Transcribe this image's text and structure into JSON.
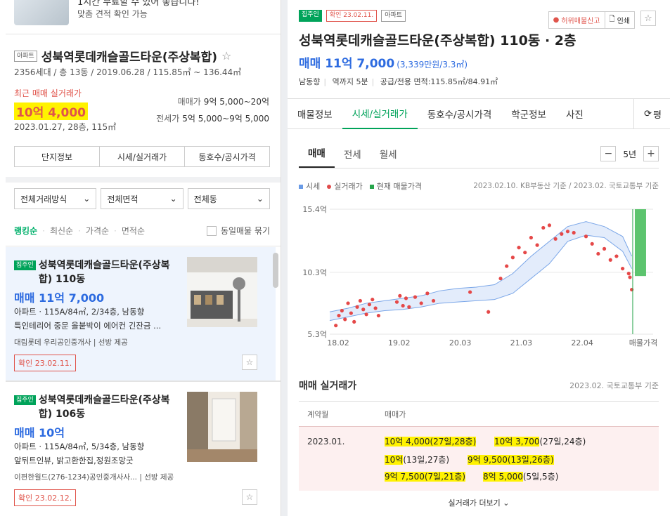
{
  "banner": {
    "line1": "1시간 무료할 수 있어 좋습니다!",
    "line2": "맞춤 견적 확인 가능"
  },
  "complex": {
    "type_tag": "아파트",
    "name": "성북역롯데캐슬골드타운(주상복합)",
    "meta": "2356세대 / 총 13동 / 2019.06.28 / 115.85㎡ ~ 136.44㎡",
    "recent_label": "최근 매매 실거래가",
    "recent_price": "10억 4,000",
    "recent_date": "2023.01.27, 28층, 115㎡",
    "sale_label": "매매가",
    "sale_range": "9억 5,000~20억",
    "jeonse_label": "전세가",
    "jeonse_range": "5억 5,000~9억 5,000",
    "buttons": [
      "단지정보",
      "시세/실거래가",
      "동호수/공시가격"
    ]
  },
  "filters": [
    "전체거래방식",
    "전체면적",
    "전체동"
  ],
  "sorts": {
    "items": [
      "랭킹순",
      "최신순",
      "가격순",
      "면적순"
    ],
    "group_label": "동일매물 묶기"
  },
  "listings": [
    {
      "tag": "집주인",
      "title": "성북역롯데캐슬골드타운(주상복합) 110동",
      "price": "매매 11억 7,000",
      "spec": "아파트 · 115A/84㎡, 2/34층, 남동향",
      "desc": "특인테리어 중문 올붙박이 에어컨 긴잔금 ...",
      "agent": "대림롯데 우리공인중개사 | 선방 제공",
      "confirm": "확인 23.02.11."
    },
    {
      "tag": "집주인",
      "title": "성북역롯데캐슬골드타운(주상복합) 106동",
      "price": "매매 10억",
      "spec": "아파트 · 115A/84㎡, 5/34층, 남동향",
      "desc": "앞뒤트인뷰, 밝고환한집,정원조망굿",
      "agent": "이편한월드(276-1234)공인중개사사... | 선방 제공",
      "confirm": "확인 23.02.12."
    }
  ],
  "detail": {
    "tags": [
      "집주인",
      "확인 23.02.11.",
      "아파트"
    ],
    "report_label": "허위매물신고",
    "print_label": "인쇄",
    "title": "성북역롯데캐슬골드타운(주상복합) 110동 · 2층",
    "price": "매매 11억 7,000",
    "price_per": "(3,339만원/3.3㎡)",
    "meta": [
      "남동향",
      "역까지 5분",
      "공급/전용 면적:115.85㎡/84.91㎡"
    ],
    "tabs": [
      "매물정보",
      "시세/실거래가",
      "동호수/공시가격",
      "학군정보",
      "사진"
    ],
    "refresh_label": "평",
    "subtabs": [
      "매매",
      "전세",
      "월세"
    ],
    "period": "5년",
    "legend": [
      "시세",
      "실거래가",
      "현재 매물가격"
    ],
    "basis": "2023.02.10. KB부동산 기준 / 2023.02. 국토교통부 기준",
    "section_title": "매매 실거래가",
    "section_basis": "2023.02. 국토교통부 기준",
    "col_contract": "계약월",
    "col_price": "매매가",
    "month": "2023.01.",
    "deals": [
      {
        "price": "10억 4,000",
        "info": "(27일,28층)"
      },
      {
        "price": "10억 3,700",
        "info": "(27일,24층)"
      },
      {
        "price": "10억",
        "info": "(13일,27층)"
      },
      {
        "price": "9억 9,500",
        "info": "(13일,26층)"
      },
      {
        "price": "9억 7,500",
        "info": "(7일,21층)"
      },
      {
        "price": "8억 5,000",
        "info": "(5일,5층)"
      }
    ],
    "more_label": "실거래가 더보기"
  },
  "colors": {
    "accent_green": "#00a35a",
    "price_blue": "#2d6be0",
    "red": "#e0544b",
    "highlight": "#fff200"
  },
  "chart_data": {
    "type": "scatter",
    "y_unit": "억",
    "ylim": [
      5.3,
      15.4
    ],
    "yticks": [
      "15.4억",
      "10.3억",
      "5.3억"
    ],
    "xticks": [
      "18.02",
      "19.02",
      "20.03",
      "21.03",
      "22.04",
      "매물가격"
    ],
    "series": [
      {
        "name": "시세",
        "type": "band",
        "x": [
          0,
          0.3,
          0.6,
          0.9,
          1.2,
          1.5,
          1.8,
          2.1,
          2.4,
          2.7,
          3.0,
          3.3,
          3.6,
          3.9,
          4.2,
          4.5,
          4.8,
          4.95
        ],
        "low": [
          6.4,
          6.7,
          7.0,
          7.2,
          7.3,
          7.5,
          7.8,
          7.9,
          8.0,
          8.1,
          8.6,
          9.8,
          11.0,
          12.8,
          13.3,
          13.1,
          12.0,
          10.6
        ],
        "high": [
          7.1,
          7.4,
          7.8,
          8.0,
          8.2,
          8.4,
          8.8,
          9.0,
          9.1,
          9.3,
          10.2,
          11.6,
          12.8,
          14.0,
          14.4,
          14.0,
          13.2,
          11.6
        ]
      },
      {
        "name": "실거래가",
        "type": "scatter",
        "points": [
          [
            0.1,
            6.0
          ],
          [
            0.15,
            6.8
          ],
          [
            0.2,
            7.2
          ],
          [
            0.25,
            6.5
          ],
          [
            0.3,
            7.8
          ],
          [
            0.35,
            7.0
          ],
          [
            0.4,
            6.3
          ],
          [
            0.45,
            7.5
          ],
          [
            0.5,
            8.0
          ],
          [
            0.55,
            7.3
          ],
          [
            0.6,
            6.9
          ],
          [
            0.65,
            7.7
          ],
          [
            0.7,
            8.1
          ],
          [
            0.75,
            7.4
          ],
          [
            0.8,
            6.8
          ],
          [
            1.1,
            7.9
          ],
          [
            1.15,
            8.4
          ],
          [
            1.2,
            7.6
          ],
          [
            1.25,
            8.2
          ],
          [
            1.3,
            7.5
          ],
          [
            1.4,
            8.3
          ],
          [
            1.5,
            7.8
          ],
          [
            1.6,
            8.6
          ],
          [
            1.7,
            8.0
          ],
          [
            2.3,
            8.7
          ],
          [
            2.6,
            7.1
          ],
          [
            2.8,
            9.8
          ],
          [
            2.9,
            10.8
          ],
          [
            3.0,
            11.5
          ],
          [
            3.1,
            12.3
          ],
          [
            3.2,
            11.9
          ],
          [
            3.3,
            13.1
          ],
          [
            3.4,
            12.5
          ],
          [
            3.5,
            13.9
          ],
          [
            3.6,
            14.1
          ],
          [
            3.7,
            13.0
          ],
          [
            3.8,
            13.4
          ],
          [
            3.9,
            13.6
          ],
          [
            4.0,
            13.5
          ],
          [
            4.2,
            13.2
          ],
          [
            4.3,
            12.6
          ],
          [
            4.4,
            11.8
          ],
          [
            4.5,
            12.2
          ],
          [
            4.6,
            11.3
          ],
          [
            4.7,
            11.6
          ],
          [
            4.8,
            10.6
          ],
          [
            4.9,
            10.2
          ],
          [
            4.92,
            9.9
          ],
          [
            4.95,
            8.9
          ]
        ]
      },
      {
        "name": "현재 매물가격",
        "type": "range",
        "low": 10.0,
        "high": 15.4
      }
    ],
    "x_range": [
      0,
      5.3
    ]
  }
}
